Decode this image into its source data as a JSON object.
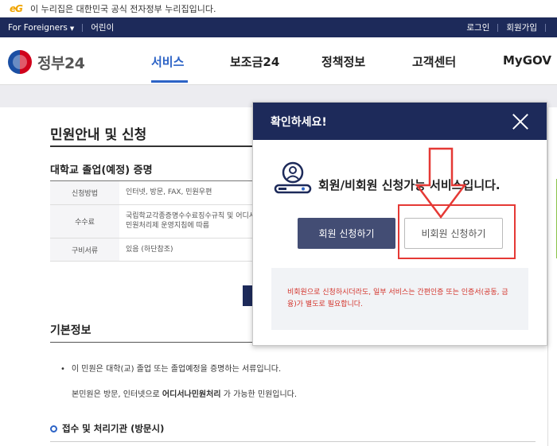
{
  "gov_bar": {
    "logo_text": "eG",
    "notice": "이 누리집은 대한민국 공식 전자정부 누리집입니다."
  },
  "top_nav": {
    "foreigners": "For Foreigners",
    "kids": "어린이",
    "login": "로그인",
    "signup": "회원가입"
  },
  "header": {
    "logo_text": "정부24",
    "menu": [
      "서비스",
      "보조금24",
      "정책정보",
      "고객센터",
      "MyGOV"
    ]
  },
  "page": {
    "title": "민원안내 및 신청",
    "cert_title": "대학교 졸업(예정) 증명",
    "table": [
      {
        "label": "신청방법",
        "value": "인터넷, 방문, FAX, 민원우편"
      },
      {
        "label": "수수료",
        "value": "국립학교각종증명수수료징수규칙 및 어디서나민원처리제 운영지침에 따름"
      },
      {
        "label": "구비서류",
        "value": "있음 (하단참조)"
      }
    ],
    "basic_title": "기본정보",
    "bullet": "이 민원은 대학(교) 졸업 또는 졸업예정을 증명하는 서류입니다.",
    "desc_prefix": "본민원은 방문, 인터넷으로 ",
    "desc_bold": "어디서나민원처리",
    "desc_suffix": " 가 가능한 민원입니다.",
    "org_title": "접수 및 처리기관 (방문시)"
  },
  "modal": {
    "title": "확인하세요!",
    "message": "회원/비회원 신청가능 서비스입니다.",
    "member_button": "회원 신청하기",
    "guest_button": "비회원 신청하기",
    "notice": "비회원으로 신청하시더라도, 일부 서비스는 간편인증 또는 인증서(공동, 금융)가 별도로 필요합니다."
  },
  "colors": {
    "navy": "#1d2a5a",
    "accent": "#2c63c6",
    "annotation": "#e53935"
  }
}
